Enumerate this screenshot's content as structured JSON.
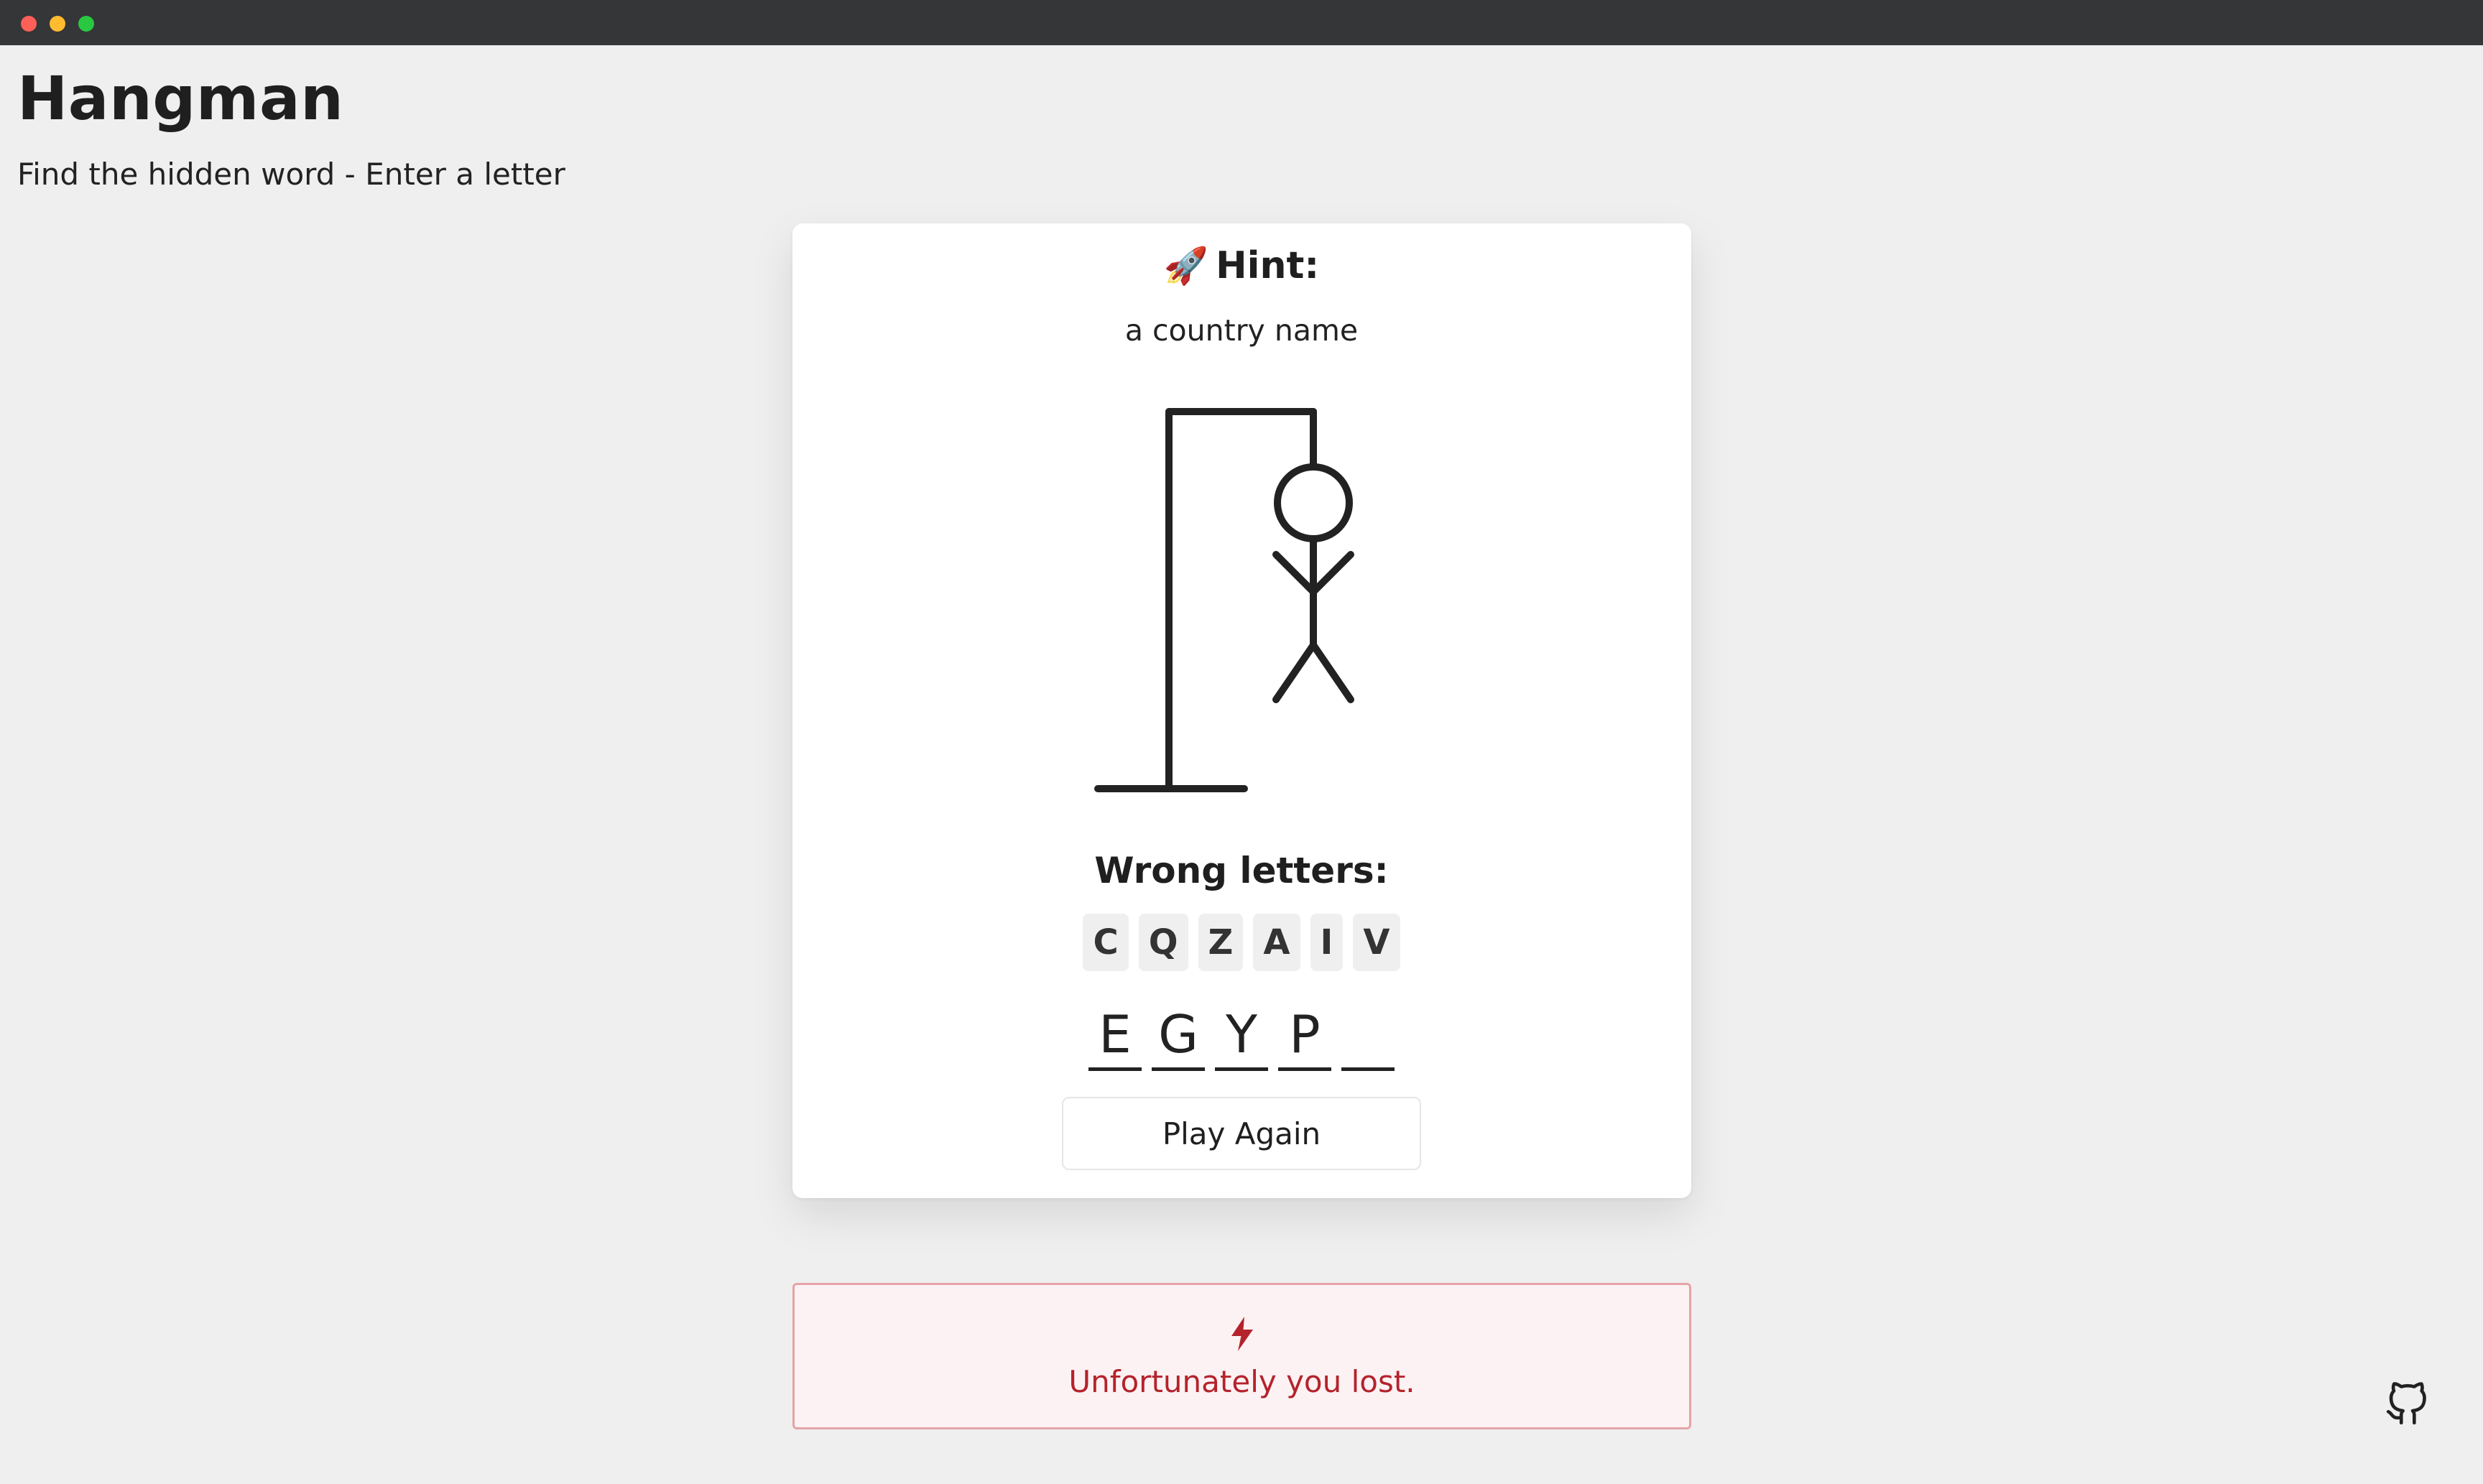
{
  "header": {
    "title": "Hangman",
    "subtitle": "Find the hidden word - Enter a letter"
  },
  "hint": {
    "icon": "rocket-emoji",
    "title": "Hint:",
    "text": "a country name"
  },
  "drawing": {
    "parts_shown": [
      "base",
      "pole",
      "beam",
      "rope",
      "head",
      "body",
      "left-arm",
      "right-arm",
      "left-leg",
      "right-leg"
    ]
  },
  "wrong_letters": {
    "title": "Wrong letters:",
    "letters": [
      "C",
      "Q",
      "Z",
      "A",
      "I",
      "V"
    ]
  },
  "word": {
    "slots": [
      "E",
      "G",
      "Y",
      "P",
      ""
    ]
  },
  "actions": {
    "play_again": "Play Again"
  },
  "alert": {
    "icon": "lightning-icon",
    "text": "Unfortunately you lost.",
    "color": "#b4232c",
    "background": "#fdf2f3"
  },
  "footer": {
    "icon": "github-icon"
  }
}
